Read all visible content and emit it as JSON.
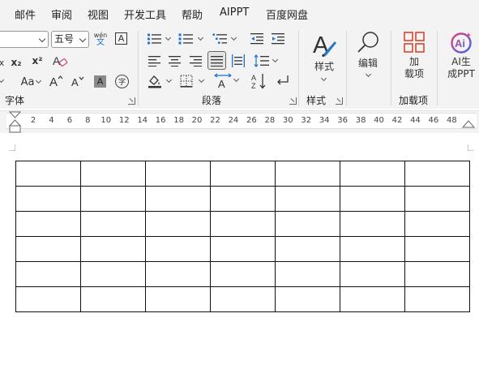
{
  "menu": {
    "items": [
      "邮件",
      "审阅",
      "视图",
      "开发工具",
      "帮助",
      "AIPPT",
      "百度网盘"
    ]
  },
  "font": {
    "name_value": "",
    "size_value": "五号",
    "phonetic_top": "wén",
    "phonetic_bottom": "文",
    "subscript_label": "x₂",
    "superscript_label": "x²",
    "change_case_label": "Aa",
    "grow_label": "A^",
    "shrink_label": "Aˇ",
    "shade_label": "A",
    "enclose_label": "字",
    "group_label": "字体"
  },
  "paragraph": {
    "group_label": "段落"
  },
  "styles": {
    "button_label": "样式",
    "group_label": "样式"
  },
  "editing": {
    "button_label": "编辑"
  },
  "addins": {
    "button_label_line1": "加",
    "button_label_line2": "载项",
    "group_label": "加载项"
  },
  "ai": {
    "button_label_line1": "AI生",
    "button_label_line2": "成PPT"
  },
  "ruler": {
    "ticks": [
      "2",
      "4",
      "6",
      "8",
      "10",
      "12",
      "14",
      "16",
      "18",
      "20",
      "22",
      "24",
      "26",
      "28",
      "30",
      "32",
      "34",
      "36",
      "38",
      "40",
      "42",
      "44",
      "46",
      "48"
    ]
  },
  "document": {
    "table": {
      "rows": 6,
      "columns": 7,
      "cells": [
        [
          "",
          "",
          "",
          "",
          "",
          "",
          ""
        ],
        [
          "",
          "",
          "",
          "",
          "",
          "",
          ""
        ],
        [
          "",
          "",
          "",
          "",
          "",
          "",
          ""
        ],
        [
          "",
          "",
          "",
          "",
          "",
          "",
          ""
        ],
        [
          "",
          "",
          "",
          "",
          "",
          "",
          ""
        ],
        [
          "",
          "",
          "",
          "",
          "",
          "",
          ""
        ]
      ]
    }
  },
  "colors": {
    "ribbon_bg": "#f3f3f3",
    "accent_blue": "#1f6fd1",
    "addins_red": "#d8462f",
    "ai_gradient_a": "#e0447b",
    "ai_gradient_b": "#3a63f0"
  }
}
